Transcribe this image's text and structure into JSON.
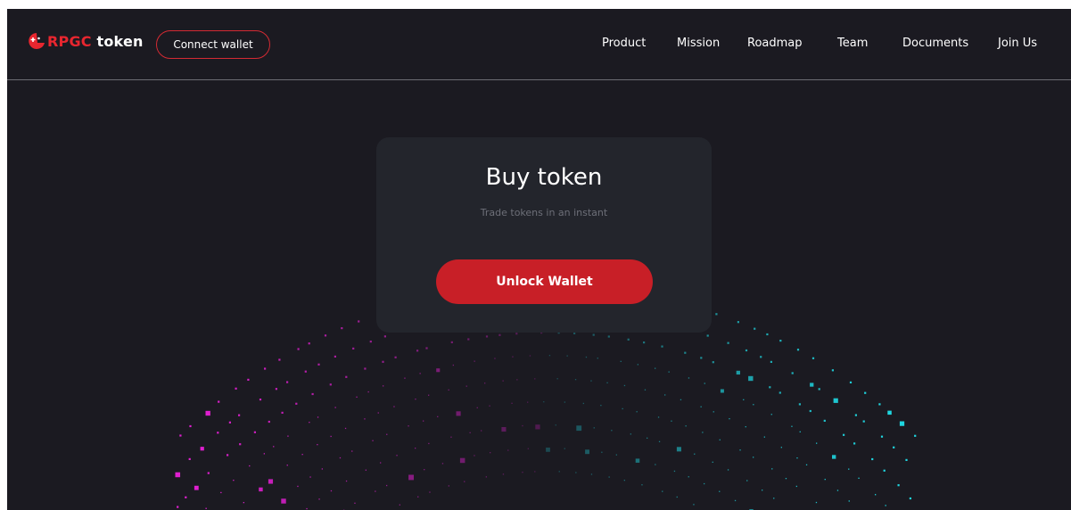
{
  "brand": {
    "name_accent": "RPGC",
    "name_rest": " token",
    "accent_color": "#e8262f"
  },
  "header": {
    "connect_wallet_label": "Connect wallet",
    "nav": [
      "Product",
      "Mission",
      "Roadmap",
      "Team",
      "Documents",
      "Join Us"
    ]
  },
  "buy_card": {
    "title": "Buy token",
    "subtitle": "Trade tokens in an instant",
    "unlock_label": "Unlock Wallet",
    "button_color": "#c81f27"
  },
  "theme": {
    "background": "#1b1a21",
    "card_background": "#23252c",
    "particle_magenta": "#e01fd0",
    "particle_cyan": "#1fd6e0"
  }
}
